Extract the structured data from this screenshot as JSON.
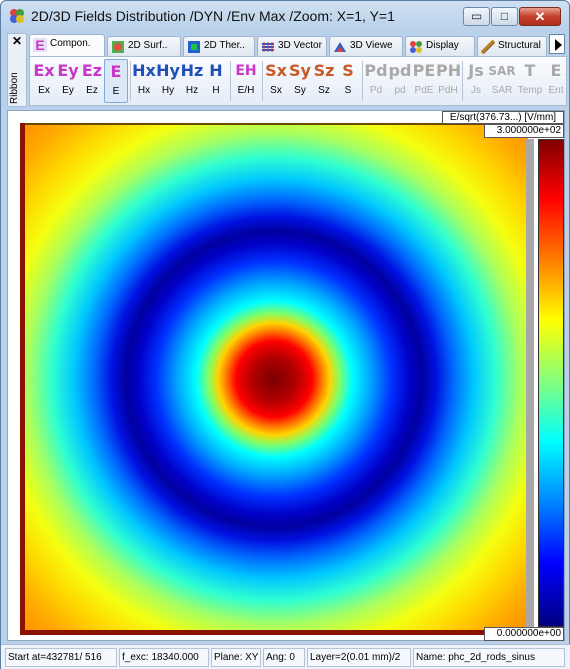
{
  "window": {
    "title": "2D/3D Fields Distribution /DYN /Env Max /Zoom: X=1, Y=1",
    "minimize": "▭",
    "maximize": "□",
    "close": "✕"
  },
  "ribbon": {
    "close": "✕",
    "label": "Ribbon"
  },
  "tabs": [
    {
      "label": "Compon.",
      "icon": "component-e-icon"
    },
    {
      "label": "2D Surf..",
      "icon": "surface-icon"
    },
    {
      "label": "2D Ther..",
      "icon": "thermal-icon"
    },
    {
      "label": "3D Vector",
      "icon": "vector-icon"
    },
    {
      "label": "3D Viewe",
      "icon": "viewer-icon"
    },
    {
      "label": "Display",
      "icon": "display-icon"
    },
    {
      "label": "Structural",
      "icon": "structural-icon"
    }
  ],
  "toolbar": {
    "buttons": [
      {
        "big": "Ex",
        "label": "Ex"
      },
      {
        "big": "Ey",
        "label": "Ey"
      },
      {
        "big": "Ez",
        "label": "Ez"
      },
      {
        "big": "E",
        "label": "E"
      },
      {
        "big": "Hx",
        "label": "Hx"
      },
      {
        "big": "Hy",
        "label": "Hy"
      },
      {
        "big": "Hz",
        "label": "Hz"
      },
      {
        "big": "H",
        "label": "H"
      },
      {
        "big": "EH",
        "label": "E/H"
      },
      {
        "big": "Sx",
        "label": "Sx"
      },
      {
        "big": "Sy",
        "label": "Sy"
      },
      {
        "big": "Sz",
        "label": "Sz"
      },
      {
        "big": "S",
        "label": "S"
      },
      {
        "big": "Pd",
        "label": "Pd"
      },
      {
        "big": "pd",
        "label": "pd"
      },
      {
        "big": "PE",
        "label": "PdE"
      },
      {
        "big": "PH",
        "label": "PdH"
      },
      {
        "big": "Js",
        "label": "Js"
      },
      {
        "big": "SAR",
        "label": "SAR"
      },
      {
        "big": "T",
        "label": "Temp"
      },
      {
        "big": "E",
        "label": "Ent"
      }
    ]
  },
  "colorbar": {
    "title": "E/sqrt(376.73...) [V/mm]",
    "max": "3.000000e+02",
    "min": "0.000000e+00"
  },
  "status": {
    "start": "Start at=432781/ 516",
    "fexc": "f_exc: 18340.000",
    "plane": "Plane: XY",
    "ang": "Ang:   0",
    "layer": "Layer=2(0.01 mm)/2",
    "name": "Name: phc_2d_rods_sinus"
  },
  "colors": {
    "title_bg": "#b9d1ea",
    "close_button": "#c4402a",
    "e_component": "#c837c8",
    "h_component": "#1f4fb8",
    "s_component": "#c85a28"
  }
}
